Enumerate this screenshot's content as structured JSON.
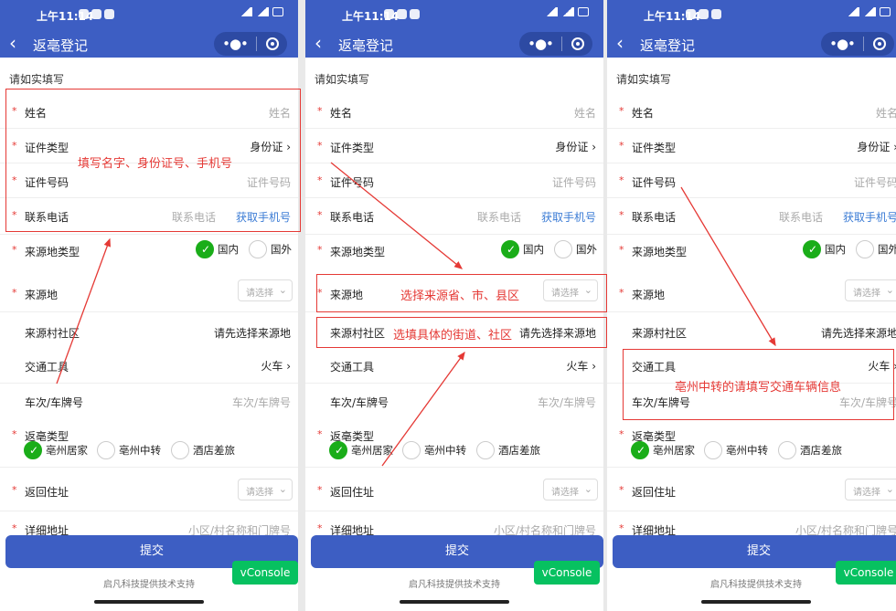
{
  "phones": [
    {
      "status_time": "上午11:14",
      "nav_title": "返亳登记",
      "hint": "请如实填写",
      "name_label": "姓名",
      "name_ph": "姓名",
      "idtype_label": "证件类型",
      "idtype_val": "身份证",
      "idno_label": "证件号码",
      "idno_ph": "证件号码",
      "phone_label": "联系电话",
      "phone_ph": "联系电话",
      "phone_link": "获取手机号",
      "origin_type_label": "来源地类型",
      "domestic": "国内",
      "abroad": "国外",
      "origin_label": "来源地",
      "select_ph": "请选择",
      "village_label": "来源村社区",
      "village_val": "请先选择来源地",
      "transport_label": "交通工具",
      "transport_val": "火车",
      "plate_label": "车次/车牌号",
      "plate_ph": "车次/车牌号",
      "return_type_label": "返亳类型",
      "rt1": "亳州居家",
      "rt2": "亳州中转",
      "rt3": "酒店差旅",
      "addr_label": "返回住址",
      "detail_label": "详细地址",
      "detail_ph": "小区/村名称和门牌号",
      "submit": "提交",
      "footer": "启凡科技提供技术支持",
      "vconsole": "vConsole"
    },
    {
      "status_time": "上午11:14",
      "nav_title": "返亳登记",
      "hint": "请如实填写",
      "name_label": "姓名",
      "name_ph": "姓名",
      "idtype_label": "证件类型",
      "idtype_val": "身份证",
      "idno_label": "证件号码",
      "idno_ph": "证件号码",
      "phone_label": "联系电话",
      "phone_ph": "联系电话",
      "phone_link": "获取手机号",
      "origin_type_label": "来源地类型",
      "domestic": "国内",
      "abroad": "国外",
      "origin_label": "来源地",
      "select_ph": "请选择",
      "village_label": "来源村社区",
      "village_val": "请先选择来源地",
      "transport_label": "交通工具",
      "transport_val": "火车",
      "plate_label": "车次/车牌号",
      "plate_ph": "车次/车牌号",
      "return_type_label": "返亳类型",
      "rt1": "亳州居家",
      "rt2": "亳州中转",
      "rt3": "酒店差旅",
      "addr_label": "返回住址",
      "detail_label": "详细地址",
      "detail_ph": "小区/村名称和门牌号",
      "submit": "提交",
      "footer": "启凡科技提供技术支持",
      "vconsole": "vConsole"
    },
    {
      "status_time": "上午11:14",
      "nav_title": "返亳登记",
      "hint": "请如实填写",
      "name_label": "姓名",
      "name_ph": "姓名",
      "idtype_label": "证件类型",
      "idtype_val": "身份证",
      "idno_label": "证件号码",
      "idno_ph": "证件号码",
      "phone_label": "联系电话",
      "phone_ph": "联系电话",
      "phone_link": "获取手机号",
      "origin_type_label": "来源地类型",
      "domestic": "国内",
      "abroad": "国外",
      "origin_label": "来源地",
      "select_ph": "请选择",
      "village_label": "来源村社区",
      "village_val": "请先选择来源地",
      "transport_label": "交通工具",
      "transport_val": "火车",
      "plate_label": "车次/车牌号",
      "plate_ph": "车次/车牌号",
      "return_type_label": "返亳类型",
      "rt1": "亳州居家",
      "rt2": "亳州中转",
      "rt3": "酒店差旅",
      "addr_label": "返回住址",
      "detail_label": "详细地址",
      "detail_ph": "小区/村名称和门牌号",
      "submit": "提交",
      "footer": "启凡科技提供技术支持",
      "vconsole": "vConsole"
    }
  ],
  "annotations": {
    "a1": "填写名字、身份证号、手机号",
    "a2": "选择来源省、市、县区",
    "a3": "选填具体的街道、社区",
    "a4": "亳州中转的请填写交通车辆信息"
  },
  "colors": {
    "primary": "#3d5ec3",
    "annotation": "#e53935",
    "check": "#1aad19",
    "vconsole": "#07c160"
  }
}
